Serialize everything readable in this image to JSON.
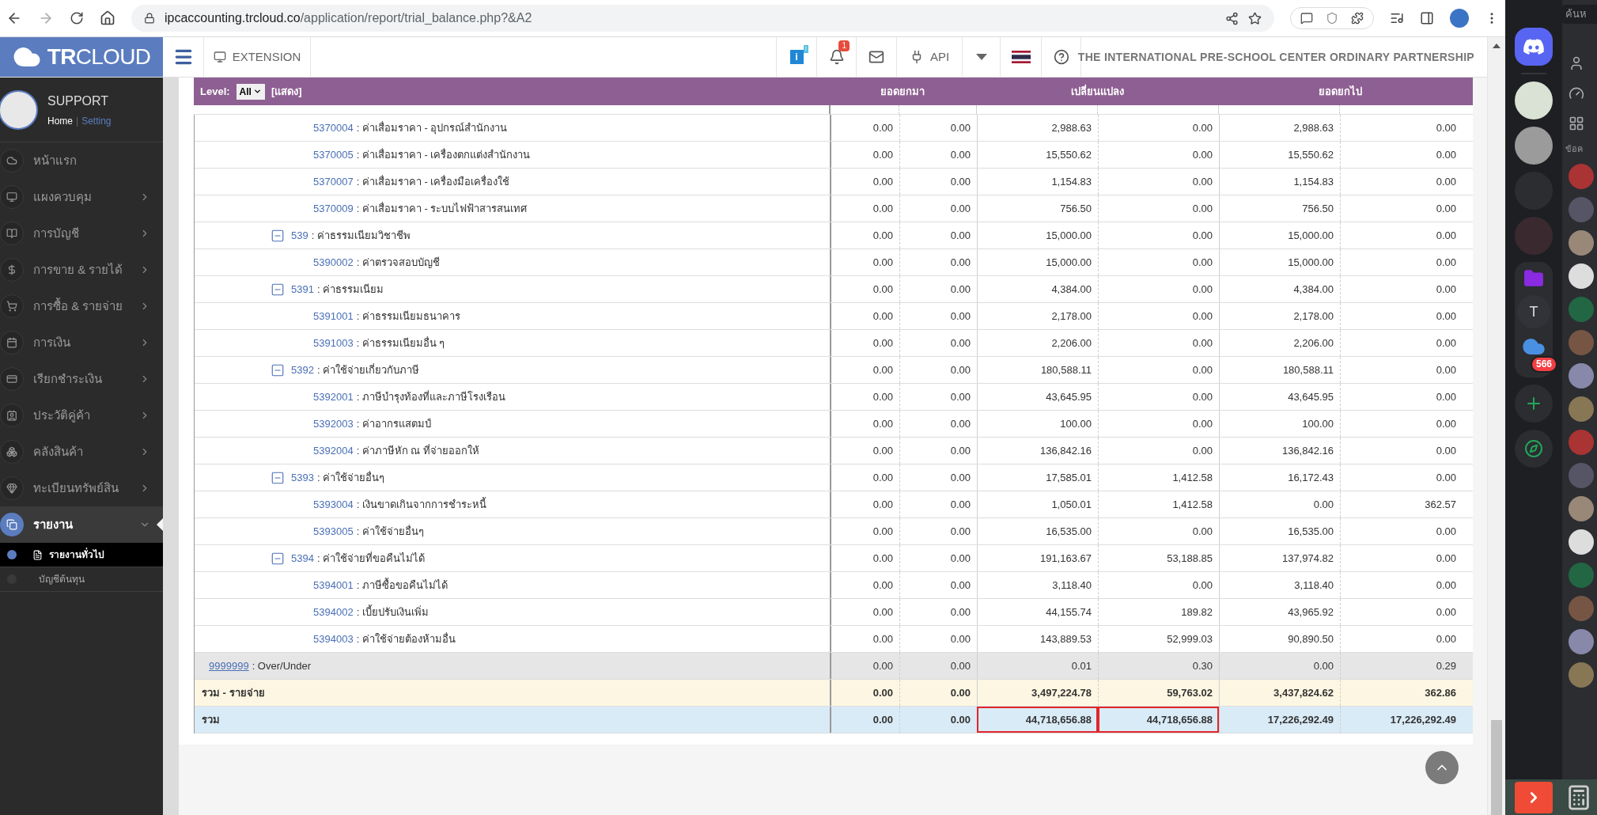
{
  "browser": {
    "url_host": "ipcaccounting.trcloud.co",
    "url_path": "/application/report/trial_balance.php?&A2"
  },
  "header": {
    "logo": "**TR**CLOUD",
    "extension": "EXTENSION",
    "info": "i",
    "info_badge": "!",
    "notification_count": "1",
    "api": "API",
    "company": "THE INTERNATIONAL PRE-SCHOOL CENTER ORDINARY PARTNERSHIP"
  },
  "user": {
    "name": "SUPPORT",
    "home": "Home",
    "separator": "|",
    "setting": "Setting"
  },
  "sidebar": {
    "items": [
      {
        "label": "หน้าแรก",
        "has_submenu": false,
        "selected": false
      },
      {
        "label": "แผงควบคุม",
        "has_submenu": true,
        "selected": false
      },
      {
        "label": "การบัญชี",
        "has_submenu": true,
        "selected": false
      },
      {
        "label": "การขาย & รายได้",
        "has_submenu": true,
        "selected": false
      },
      {
        "label": "การซื้อ & รายจ่าย",
        "has_submenu": true,
        "selected": false
      },
      {
        "label": "การเงิน",
        "has_submenu": true,
        "selected": false
      },
      {
        "label": "เรียกชำระเงิน",
        "has_submenu": true,
        "selected": false
      },
      {
        "label": "ประวัติคู่ค้า",
        "has_submenu": true,
        "selected": false
      },
      {
        "label": "คลังสินค้า",
        "has_submenu": true,
        "selected": false
      },
      {
        "label": "ทะเบียนทรัพย์สิน",
        "has_submenu": true,
        "selected": false
      },
      {
        "label": "รายงาน",
        "has_submenu": true,
        "selected": true,
        "expanded": true,
        "children": [
          {
            "label": "รายงานทั่วไป",
            "selected": true
          },
          {
            "label": "บัญชีต้นทุน",
            "selected": false
          }
        ]
      }
    ]
  },
  "report": {
    "level_label": "Level:",
    "level_value": "All",
    "show_link": "[แสดง]",
    "column_groups": [
      "ยอดยกมา",
      "เปลี่ยนแปลง",
      "ยอดยกไป"
    ],
    "rows": [
      {
        "kind": "account",
        "code": "5370004",
        "name": ": ค่าเสื่อมราคา - อุปกรณ์สำนักงาน",
        "values": [
          "0.00",
          "0.00",
          "2,988.63",
          "0.00",
          "2,988.63",
          "0.00"
        ]
      },
      {
        "kind": "account",
        "code": "5370005",
        "name": ": ค่าเสื่อมราคา - เครื่องตกแต่งสำนักงาน",
        "values": [
          "0.00",
          "0.00",
          "15,550.62",
          "0.00",
          "15,550.62",
          "0.00"
        ]
      },
      {
        "kind": "account",
        "code": "5370007",
        "name": ": ค่าเสื่อมราคา - เครื่องมือเครื่องใช้",
        "values": [
          "0.00",
          "0.00",
          "1,154.83",
          "0.00",
          "1,154.83",
          "0.00"
        ]
      },
      {
        "kind": "account",
        "code": "5370009",
        "name": ": ค่าเสื่อมราคา - ระบบไฟฟ้าสารสนเทศ",
        "values": [
          "0.00",
          "0.00",
          "756.50",
          "0.00",
          "756.50",
          "0.00"
        ]
      },
      {
        "kind": "group",
        "expanded": true,
        "code": "539",
        "name": ": ค่าธรรมเนียมวิชาชีพ",
        "values": [
          "0.00",
          "0.00",
          "15,000.00",
          "0.00",
          "15,000.00",
          "0.00"
        ]
      },
      {
        "kind": "account",
        "code": "5390002",
        "name": ": ค่าตรวจสอบบัญชี",
        "values": [
          "0.00",
          "0.00",
          "15,000.00",
          "0.00",
          "15,000.00",
          "0.00"
        ]
      },
      {
        "kind": "group",
        "expanded": true,
        "code": "5391",
        "name": ": ค่าธรรมเนียม",
        "values": [
          "0.00",
          "0.00",
          "4,384.00",
          "0.00",
          "4,384.00",
          "0.00"
        ]
      },
      {
        "kind": "account",
        "code": "5391001",
        "name": ": ค่าธรรมเนียมธนาคาร",
        "values": [
          "0.00",
          "0.00",
          "2,178.00",
          "0.00",
          "2,178.00",
          "0.00"
        ]
      },
      {
        "kind": "account",
        "code": "5391003",
        "name": ": ค่าธรรมเนียมอื่น ๆ",
        "values": [
          "0.00",
          "0.00",
          "2,206.00",
          "0.00",
          "2,206.00",
          "0.00"
        ]
      },
      {
        "kind": "group",
        "expanded": true,
        "code": "5392",
        "name": ": ค่าใช้จ่ายเกี่ยวกับภาษี",
        "values": [
          "0.00",
          "0.00",
          "180,588.11",
          "0.00",
          "180,588.11",
          "0.00"
        ]
      },
      {
        "kind": "account",
        "code": "5392001",
        "name": ": ภาษีบำรุงท้องที่และภาษีโรงเรือน",
        "values": [
          "0.00",
          "0.00",
          "43,645.95",
          "0.00",
          "43,645.95",
          "0.00"
        ]
      },
      {
        "kind": "account",
        "code": "5392003",
        "name": ": ค่าอากรแสตมป์",
        "values": [
          "0.00",
          "0.00",
          "100.00",
          "0.00",
          "100.00",
          "0.00"
        ]
      },
      {
        "kind": "account",
        "code": "5392004",
        "name": ": ค่าภาษีหัก ณ ที่จ่ายออกให้",
        "values": [
          "0.00",
          "0.00",
          "136,842.16",
          "0.00",
          "136,842.16",
          "0.00"
        ]
      },
      {
        "kind": "group",
        "expanded": true,
        "code": "5393",
        "name": ": ค่าใช้จ่ายอื่นๆ",
        "values": [
          "0.00",
          "0.00",
          "17,585.01",
          "1,412.58",
          "16,172.43",
          "0.00"
        ]
      },
      {
        "kind": "account",
        "code": "5393004",
        "name": ": เงินขาดเกินจากการชำระหนี้",
        "values": [
          "0.00",
          "0.00",
          "1,050.01",
          "1,412.58",
          "0.00",
          "362.57"
        ]
      },
      {
        "kind": "account",
        "code": "5393005",
        "name": ": ค่าใช้จ่ายอื่นๆ",
        "values": [
          "0.00",
          "0.00",
          "16,535.00",
          "0.00",
          "16,535.00",
          "0.00"
        ]
      },
      {
        "kind": "group",
        "expanded": true,
        "code": "5394",
        "name": ": ค่าใช้จ่ายที่ขอคืนไม่ได้",
        "values": [
          "0.00",
          "0.00",
          "191,163.67",
          "53,188.85",
          "137,974.82",
          "0.00"
        ]
      },
      {
        "kind": "account",
        "code": "5394001",
        "name": ": ภาษีซื้อขอคืนไม่ได้",
        "values": [
          "0.00",
          "0.00",
          "3,118.40",
          "0.00",
          "3,118.40",
          "0.00"
        ]
      },
      {
        "kind": "account",
        "code": "5394002",
        "name": ": เบี้ยปรับเงินเพิ่ม",
        "values": [
          "0.00",
          "0.00",
          "44,155.74",
          "189.82",
          "43,965.92",
          "0.00"
        ]
      },
      {
        "kind": "account",
        "code": "5394003",
        "name": ": ค่าใช้จ่ายต้องห้ามอื่น",
        "values": [
          "0.00",
          "0.00",
          "143,889.53",
          "52,999.03",
          "90,890.50",
          "0.00"
        ]
      },
      {
        "kind": "overunder",
        "code": "9999999",
        "name": ": Over/Under",
        "values": [
          "0.00",
          "0.00",
          "0.01",
          "0.30",
          "0.00",
          "0.29"
        ]
      },
      {
        "kind": "subtotal",
        "name": "รวม - รายจ่าย",
        "values": [
          "0.00",
          "0.00",
          "3,497,224.78",
          "59,763.02",
          "3,437,824.62",
          "362.86"
        ]
      },
      {
        "kind": "total",
        "name": "รวม",
        "marked": true,
        "values": [
          "0.00",
          "0.00",
          "44,718,656.88",
          "44,718,656.88",
          "17,226,292.49",
          "17,226,292.49"
        ]
      }
    ]
  },
  "side_app": {
    "search_placeholder": "ค้นห",
    "folder_letter": "T",
    "cloud_badge": "566",
    "section_label": "ข้อค"
  }
}
